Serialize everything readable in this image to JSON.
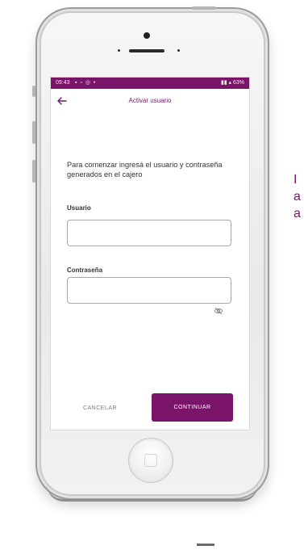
{
  "status_bar": {
    "time": "09:43",
    "left_icons": "▪ ▫ ◎ •",
    "right_text": "63%"
  },
  "app_bar": {
    "back_icon": "arrow-left-icon",
    "title": "Activar usuario"
  },
  "intro_text": "Para comenzar ingresá el usuario y contraseña generados en el cajero",
  "form": {
    "user_label": "Usuario",
    "user_value": "",
    "password_label": "Contraseña",
    "password_value": "",
    "password_toggle_icon": "eye-off-icon"
  },
  "actions": {
    "cancel_label": "CANCELAR",
    "continue_label": "CONTINUAR"
  },
  "side_text": {
    "line1": "I",
    "line2": "a",
    "line3": "a"
  },
  "colors": {
    "accent": "#7a1468",
    "text": "#333333"
  }
}
